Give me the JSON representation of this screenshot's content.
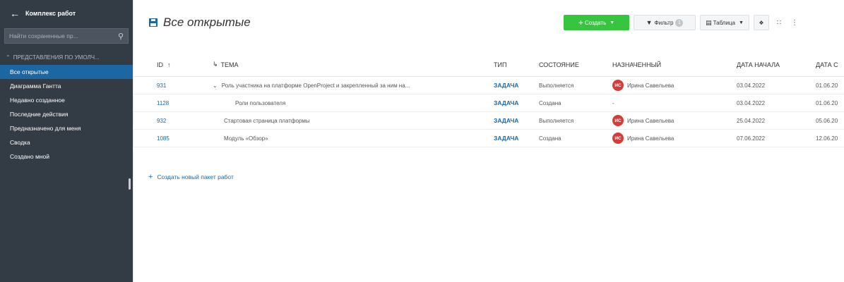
{
  "sidebar": {
    "back_icon": "arrow-left-icon",
    "title": "Комплекс работ",
    "search_placeholder": "Найти сохраненные пр...",
    "section_label": "ПРЕДСТАВЛЕНИЯ ПО УМОЛЧ...",
    "items": [
      {
        "label": "Все открытые",
        "active": true
      },
      {
        "label": "Диаграмма Гантта",
        "active": false
      },
      {
        "label": "Недавно созданное",
        "active": false
      },
      {
        "label": "Последние действия",
        "active": false
      },
      {
        "label": "Предназначено для меня",
        "active": false
      },
      {
        "label": "Сводка",
        "active": false
      },
      {
        "label": "Создано мной",
        "active": false
      }
    ]
  },
  "header": {
    "title": "Все открытые",
    "create_label": "Создать",
    "filter_label": "Фильтр",
    "filter_count": "1",
    "table_label": "Таблица",
    "info_icon": "info-icon",
    "fullscreen_icon": "fullscreen-icon",
    "more_icon": "more-vertical-icon"
  },
  "table": {
    "columns": {
      "id": "ID",
      "subject": "ТЕМА",
      "type": "ТИП",
      "status": "СОСТОЯНИЕ",
      "assignee": "НАЗНАЧЕННЫЙ",
      "start": "ДАТА НАЧАЛА",
      "due": "ДАТА С"
    },
    "rows": [
      {
        "id": "931",
        "subject": "Роль участника на платформе OpenProject и закрепленный за ним на...",
        "type": "ЗАДАЧА",
        "status": "Выполняется",
        "assignee_initials": "ИС",
        "assignee": "Ирина Савельева",
        "start": "03.04.2022",
        "due": "01.06.20"
      },
      {
        "id": "1128",
        "subject": "Роли пользователя",
        "type": "ЗАДАЧА",
        "status": "Создана",
        "assignee_initials": "",
        "assignee": "-",
        "start": "03.04.2022",
        "due": "01.06.20"
      },
      {
        "id": "932",
        "subject": "Стартовая страница платформы",
        "type": "ЗАДАЧА",
        "status": "Выполняется",
        "assignee_initials": "ИС",
        "assignee": "Ирина Савельева",
        "start": "25.04.2022",
        "due": "05.06.20"
      },
      {
        "id": "1085",
        "subject": "Модуль «Обзор»",
        "type": "ЗАДАЧА",
        "status": "Создана",
        "assignee_initials": "ИС",
        "assignee": "Ирина Савельева",
        "start": "07.06.2022",
        "due": "12.06.20"
      }
    ],
    "add_label": "Создать новый пакет работ"
  },
  "colors": {
    "sidebar_bg": "#333b45",
    "active_item": "#1a67a3",
    "create_button": "#35c53f",
    "link": "#1a67a3",
    "avatar": "#d43b3b"
  }
}
